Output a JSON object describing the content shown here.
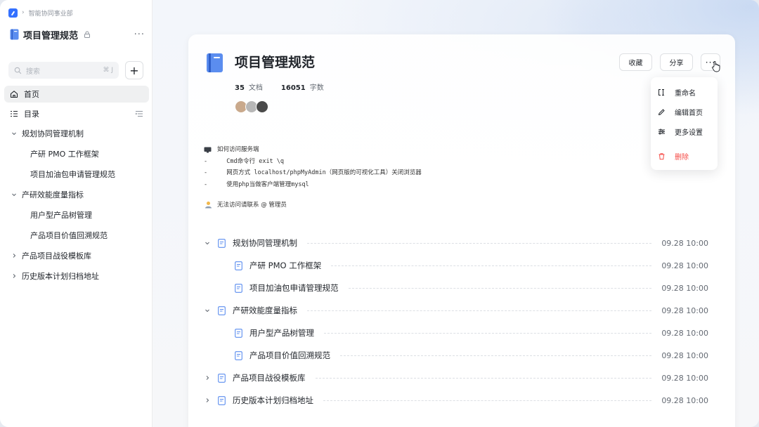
{
  "breadcrumb": {
    "separator": "›",
    "org": "智能协同事业部"
  },
  "space": {
    "title": "项目管理规范",
    "more": "···"
  },
  "search": {
    "placeholder": "搜索",
    "shortcut": "⌘ J",
    "add": "+"
  },
  "nav": [
    {
      "label": "首页",
      "icon": "home-icon",
      "active": true
    },
    {
      "label": "目录",
      "icon": "list-icon",
      "active": false
    }
  ],
  "tree": [
    {
      "label": "规划协同管理机制",
      "level": 0,
      "expanded": true
    },
    {
      "label": "产研 PMO 工作框架",
      "level": 1
    },
    {
      "label": "项目加油包申请管理规范",
      "level": 1
    },
    {
      "label": "产研效能度量指标",
      "level": 0,
      "expanded": true
    },
    {
      "label": "用户型产品树管理",
      "level": 1
    },
    {
      "label": "产品项目价值回溯规范",
      "level": 1
    },
    {
      "label": "产品项目战役模板库",
      "level": 0,
      "expanded": false
    },
    {
      "label": "历史版本计划归档地址",
      "level": 0,
      "expanded": false
    }
  ],
  "header": {
    "title": "项目管理规范",
    "doc_count": "35",
    "doc_label": "文档",
    "word_count": "16051",
    "word_label": "字数",
    "fav_label": "收藏",
    "share_label": "分享",
    "more_label": "···"
  },
  "avatars": [
    {
      "name": "avatar-1",
      "color": "#c9a98c"
    },
    {
      "name": "avatar-2",
      "color": "#b7b7b7"
    },
    {
      "name": "avatar-3",
      "color": "#4a4a4a"
    }
  ],
  "menu": [
    {
      "label": "重命名",
      "icon": "rename-icon"
    },
    {
      "label": "编辑首页",
      "icon": "edit-icon"
    },
    {
      "label": "更多设置",
      "icon": "settings-icon"
    },
    {
      "label": "删除",
      "icon": "delete-icon",
      "danger": true
    }
  ],
  "code": {
    "heading": "如何访问服务端",
    "lines": [
      {
        "dash": "-",
        "text": "  Cmd命令行 exit \\q"
      },
      {
        "dash": "-",
        "text": "  网页方式 localhost/phpMyAdmin（网页版的可视化工具）关闭浏览器"
      },
      {
        "dash": "-",
        "text": "  使用php当做客户端管理mysql"
      }
    ],
    "note": "无法访问请联系 @ 管理员"
  },
  "toc": [
    {
      "label": "规划协同管理机制",
      "level": 0,
      "expanded": true,
      "date": "09.28 10:00"
    },
    {
      "label": "产研 PMO 工作框架",
      "level": 1,
      "date": "09.28 10:00"
    },
    {
      "label": "项目加油包申请管理规范",
      "level": 1,
      "date": "09.28 10:00"
    },
    {
      "label": "产研效能度量指标",
      "level": 0,
      "expanded": true,
      "date": "09.28 10:00"
    },
    {
      "label": "用户型产品树管理",
      "level": 1,
      "date": "09.28 10:00"
    },
    {
      "label": "产品项目价值回溯规范",
      "level": 1,
      "date": "09.28 10:00"
    },
    {
      "label": "产品项目战役模板库",
      "level": 0,
      "expanded": false,
      "date": "09.28 10:00"
    },
    {
      "label": "历史版本计划归档地址",
      "level": 0,
      "expanded": false,
      "date": "09.28 10:00"
    }
  ],
  "colors": {
    "accent": "#3370ff",
    "danger": "#f54a45",
    "text": "#1f2329",
    "muted": "#646a73"
  }
}
